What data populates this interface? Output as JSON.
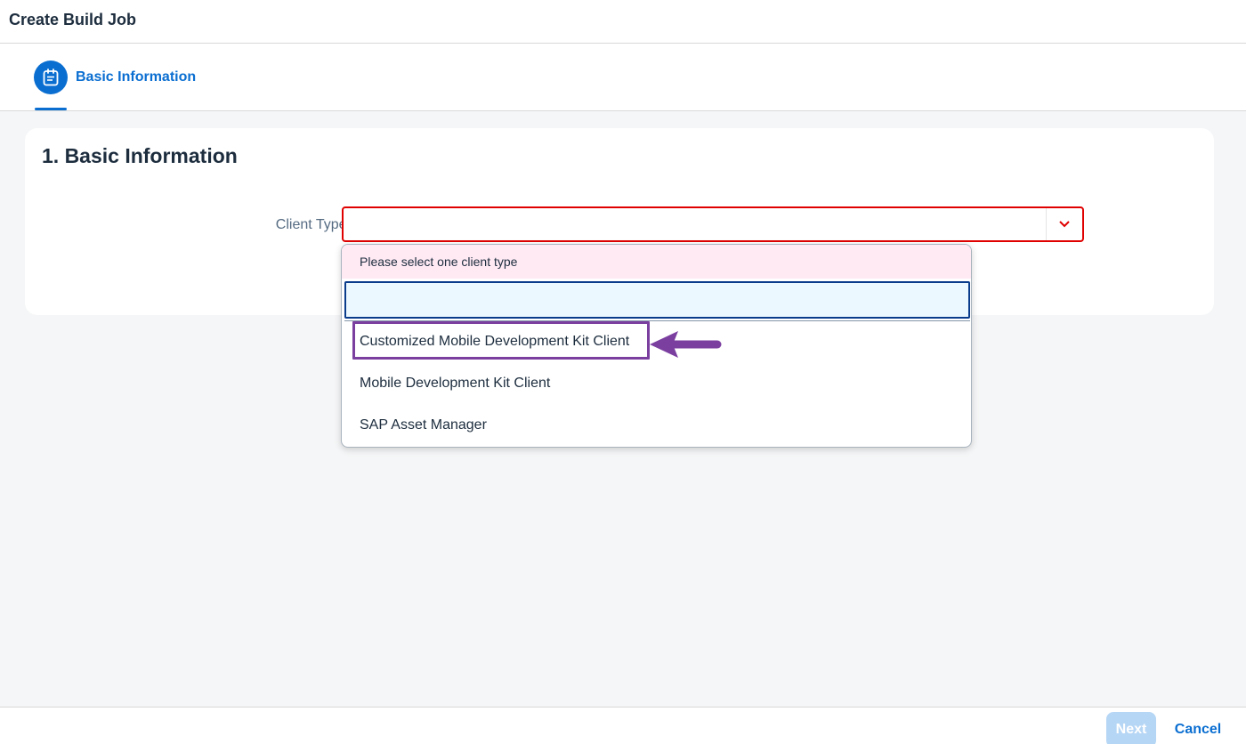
{
  "header": {
    "title": "Create Build Job"
  },
  "wizard": {
    "step": {
      "icon": "form-icon",
      "label": "Basic Information",
      "active": true
    }
  },
  "section": {
    "title": "1. Basic Information",
    "client_type": {
      "label": "Client Type:",
      "required_marker": "*",
      "value": "",
      "state": "error"
    }
  },
  "dropdown": {
    "value_state_text": "Please select one client type",
    "filter_value": "",
    "options": [
      "Customized Mobile Development Kit Client",
      "Mobile Development Kit Client",
      "SAP Asset Manager"
    ]
  },
  "footer": {
    "next_label": "Next",
    "next_enabled": false,
    "cancel_label": "Cancel"
  },
  "colors": {
    "accent": "#0a6ed1",
    "error": "#e00000",
    "annotation": "#7b3fa0"
  }
}
